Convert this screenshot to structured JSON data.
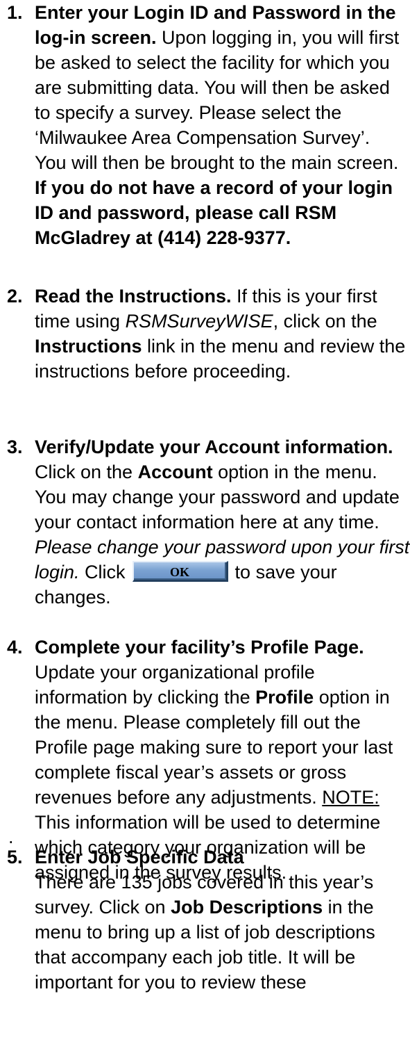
{
  "items": [
    {
      "number": "1.",
      "lines": [
        [
          {
            "b": true,
            "t": "Enter your Login ID and Password in the"
          }
        ],
        [
          {
            "b": true,
            "t": "log-in screen."
          },
          {
            "t": " Upon logging in, you will first"
          }
        ],
        [
          {
            "t": "be asked to select the facility for which you"
          }
        ],
        [
          {
            "t": "are submitting data. You will then be asked"
          }
        ],
        [
          {
            "t": "to specify a survey. Please select the"
          }
        ],
        [
          {
            "t": "‘Milwaukee Area Compensation Survey’."
          }
        ],
        [
          {
            "t": "You will then be brought to the main screen."
          }
        ],
        [
          {
            "b": true,
            "t": "If you do not have a record of your login"
          }
        ],
        [
          {
            "b": true,
            "t": "ID and password, please call RSM"
          }
        ],
        [
          {
            "b": true,
            "t": "McGladrey at (414) 228-9377."
          }
        ]
      ]
    },
    {
      "number": "2.",
      "lines": [
        [
          {
            "b": true,
            "t": "Read the Instructions."
          },
          {
            "t": "  If this is your first"
          }
        ],
        [
          {
            "t": "time using "
          },
          {
            "i": true,
            "t": "RSMSurveyWISE"
          },
          {
            "t": ", click on the"
          }
        ],
        [
          {
            "b": true,
            "t": "Instructions"
          },
          {
            "t": " link in the menu and review the"
          }
        ],
        [
          {
            "t": "instructions before proceeding."
          }
        ]
      ]
    },
    {
      "number": "3.",
      "lines": [
        [
          {
            "b": true,
            "t": "Verify/Update your Account information."
          }
        ],
        [
          {
            "t": "Click on the "
          },
          {
            "b": true,
            "t": "Account"
          },
          {
            "t": " option in the menu."
          }
        ],
        [
          {
            "t": "You may change your password and update"
          }
        ],
        [
          {
            "t": "your contact information here at any time."
          }
        ],
        [
          {
            "i": true,
            "t": "Please change your password upon your first"
          }
        ],
        [
          {
            "i": true,
            "t": "login."
          },
          {
            "t": "  Click"
          },
          {
            "button": true
          },
          {
            "t": "to save your"
          }
        ],
        [
          {
            "t": "changes."
          }
        ]
      ]
    },
    {
      "number": "4.",
      "lines": [
        [
          {
            "b": true,
            "t": "Complete your facility’s Profile Page."
          }
        ],
        [
          {
            "t": "Update your organizational profile"
          }
        ],
        [
          {
            "t": "information by clicking the "
          },
          {
            "b": true,
            "t": "Profile"
          },
          {
            "t": " option in"
          }
        ],
        [
          {
            "t": "the menu. Please completely fill out the"
          }
        ],
        [
          {
            "t": "Profile page making sure to report your last"
          }
        ],
        [
          {
            "t": "complete fiscal year’s assets or gross"
          }
        ],
        [
          {
            "t": "revenues before any adjustments.  "
          },
          {
            "u": true,
            "t": "NOTE:"
          }
        ],
        [
          {
            "t": "This information will be used to determine"
          }
        ],
        [
          {
            "t": "which category your organization will be"
          }
        ],
        [
          {
            "t": "assigned in the survey results."
          }
        ]
      ]
    },
    {
      "number": "5.",
      "lines": [
        [
          {
            "b": true,
            "t": "Enter Job Specific Data"
          }
        ],
        [
          {
            "t": "There are 135 jobs covered in this year’s"
          }
        ],
        [
          {
            "t": "survey.  Click on "
          },
          {
            "b": true,
            "t": "Job Descriptions"
          },
          {
            "t": " in the"
          }
        ],
        [
          {
            "t": "menu to bring up a list of job descriptions"
          }
        ],
        [
          {
            "t": "that accompany each job title. It will be"
          }
        ],
        [
          {
            "t": "important for you to review these"
          }
        ]
      ]
    }
  ],
  "ok_button_label": "OK",
  "stray_mark": "."
}
